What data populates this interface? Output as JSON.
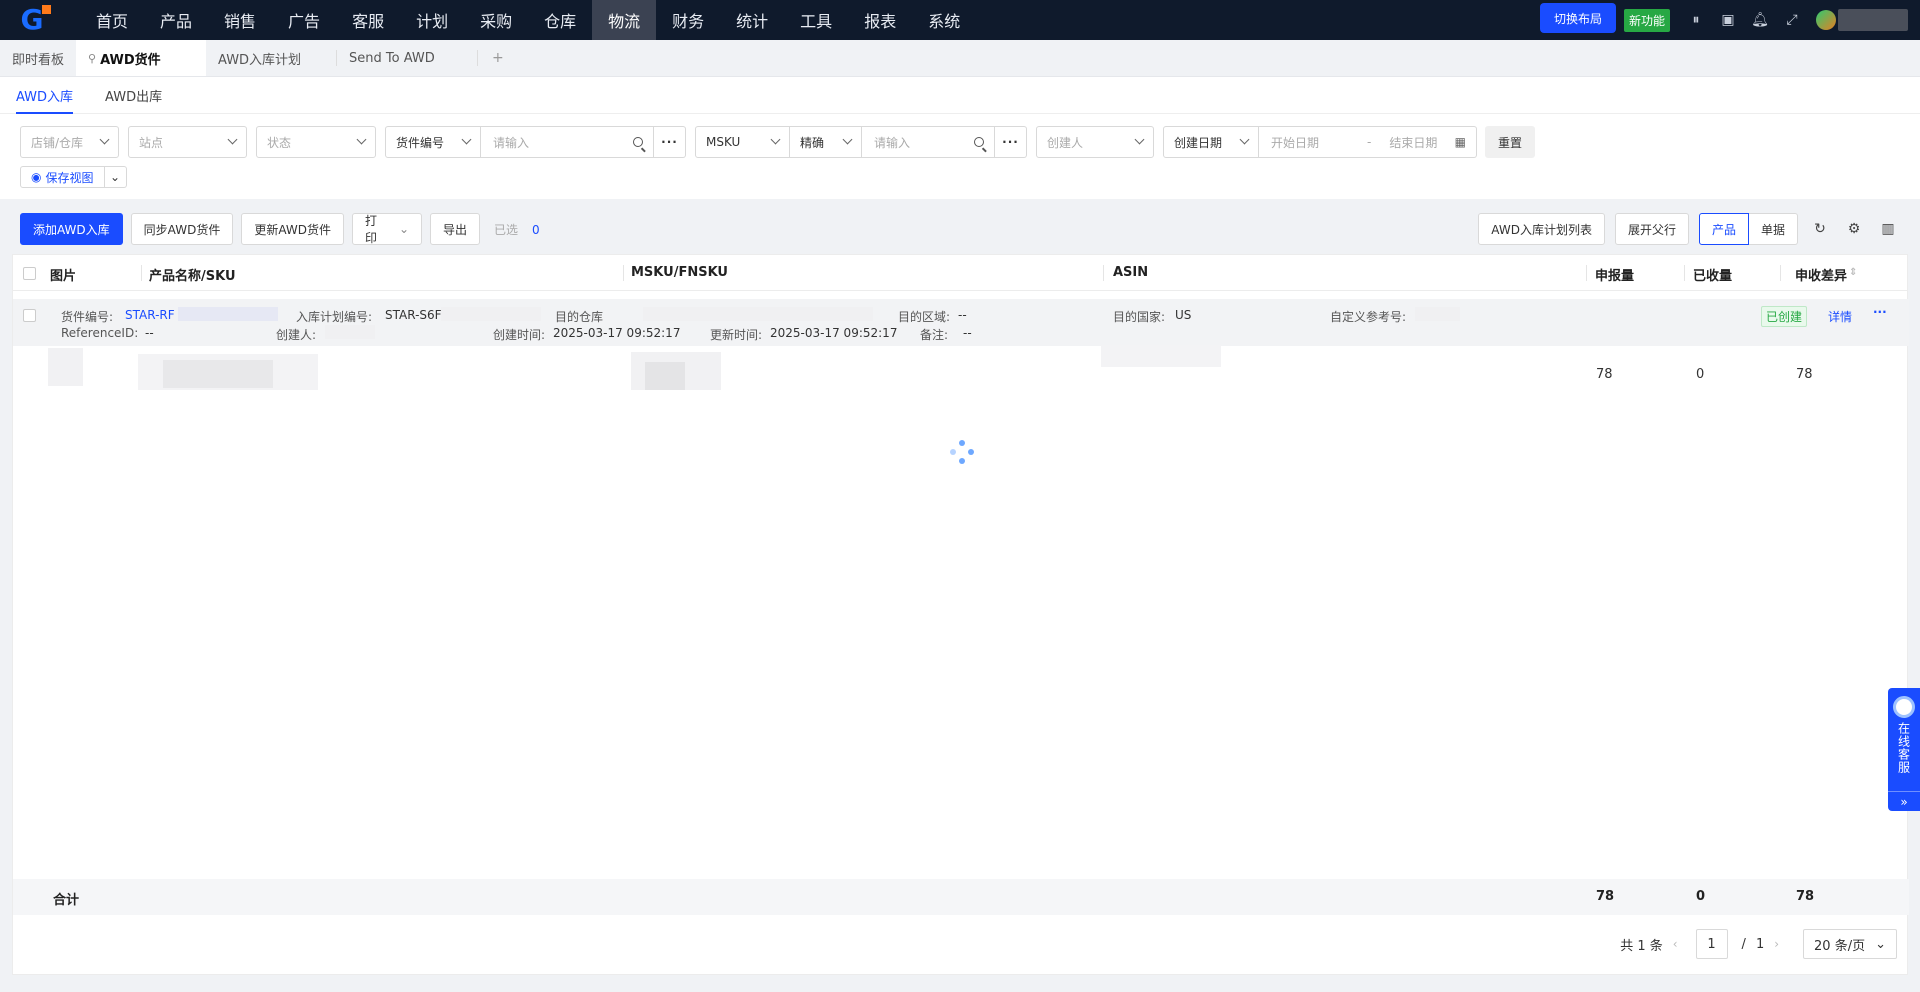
{
  "nav": {
    "items": [
      "首页",
      "产品",
      "销售",
      "广告",
      "客服",
      "计划",
      "采购",
      "仓库",
      "物流",
      "财务",
      "统计",
      "工具",
      "报表",
      "系统"
    ],
    "active_index": 8,
    "switch_layout": "切换布局",
    "new_feature": "新功能"
  },
  "tabs": {
    "dashboard": "即时看板",
    "awd_shipment": "AWD货件",
    "awd_inbound_plan": "AWD入库计划",
    "send_to_awd": "Send To AWD",
    "add": "+"
  },
  "subtabs": {
    "inbound": "AWD入库",
    "outbound": "AWD出库"
  },
  "filters": {
    "store": "店铺/仓库",
    "site": "站点",
    "status": "状态",
    "shipment_no": "货件编号",
    "input_placeholder": "请输入",
    "msku": "MSKU",
    "exact": "精确",
    "creator": "创建人",
    "create_date": "创建日期",
    "start_date": "开始日期",
    "date_sep": "-",
    "end_date": "结束日期",
    "reset": "重置",
    "save_view": "保存视图"
  },
  "toolbar": {
    "add": "添加AWD入库",
    "sync": "同步AWD货件",
    "update": "更新AWD货件",
    "print": "打印",
    "export": "导出",
    "selected_label": "已选",
    "selected_count": "0",
    "plan_list": "AWD入库计划列表",
    "expand": "展开父行",
    "view_product": "产品",
    "view_doc": "单据"
  },
  "table": {
    "headers": {
      "image": "图片",
      "product": "产品名称/SKU",
      "msku": "MSKU/FNSKU",
      "asin": "ASIN",
      "declared": "申报量",
      "received": "已收量",
      "diff": "申收差异"
    },
    "group": {
      "shipment_label": "货件编号:",
      "shipment_value": "STAR-RF",
      "plan_label": "入库计划编号:",
      "plan_value": "STAR-S6F",
      "warehouse_label": "目的仓库",
      "region_label": "目的区域:",
      "region_value": "--",
      "country_label": "目的国家:",
      "country_value": "US",
      "ref_label": "自定义参考号:",
      "refid_label": "ReferenceID:",
      "refid_value": "--",
      "creator_label": "创建人:",
      "created_label": "创建时间:",
      "created_value": "2025-03-17 09:52:17",
      "updated_label": "更新时间:",
      "updated_value": "2025-03-17 09:52:17",
      "remark_label": "备注:",
      "remark_value": "--",
      "status": "已创建",
      "detail": "详情"
    },
    "row": {
      "declared": "78",
      "received": "0",
      "diff": "78"
    },
    "footer": {
      "label": "合计",
      "declared": "78",
      "received": "0",
      "diff": "78"
    }
  },
  "pager": {
    "total": "共 1 条",
    "page": "1",
    "sep": "/",
    "pages": "1",
    "size": "20 条/页"
  },
  "service": {
    "label": "在线客服",
    "more": "»"
  }
}
